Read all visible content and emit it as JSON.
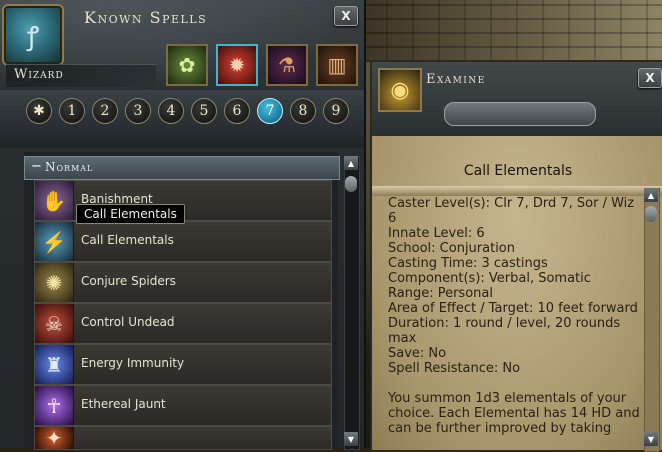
{
  "known_spells": {
    "title": "Known Spells",
    "close_label": "X",
    "class_name": "Wizard",
    "schools": [
      {
        "icon": "green-flower-icon",
        "glyph": "✿"
      },
      {
        "icon": "red-flame-icon",
        "glyph": "✹"
      },
      {
        "icon": "potion-flask-icon",
        "glyph": "⚗"
      },
      {
        "icon": "scroll-case-icon",
        "glyph": "▥"
      }
    ],
    "levels": [
      "✱",
      "1",
      "2",
      "3",
      "4",
      "5",
      "6",
      "7",
      "8",
      "9"
    ],
    "active_level": "7",
    "section_label": "Normal",
    "tooltip": "Call Elementals",
    "spells": [
      {
        "name": "Banishment",
        "icon": "banishment-icon",
        "glyph": "✋",
        "color": "#5a3a6a"
      },
      {
        "name": "Call Elementals",
        "icon": "call-elementals-icon",
        "glyph": "⚡",
        "color": "#2c5a78"
      },
      {
        "name": "Conjure Spiders",
        "icon": "spider-icon",
        "glyph": "✺",
        "color": "#6a5a2a"
      },
      {
        "name": "Control Undead",
        "icon": "skeleton-icon",
        "glyph": "☠",
        "color": "#6a2020"
      },
      {
        "name": "Energy Immunity",
        "icon": "energy-figure-icon",
        "glyph": "♜",
        "color": "#2a4ab0"
      },
      {
        "name": "Ethereal Jaunt",
        "icon": "ethereal-figure-icon",
        "glyph": "☥",
        "color": "#5a2aa0"
      },
      {
        "name": "",
        "icon": "partial-spell-icon",
        "glyph": "✦",
        "color": "#6a2a10"
      }
    ]
  },
  "examine": {
    "title": "Examine",
    "close_label": "X",
    "spell_title": "Call Elementals",
    "lines": [
      "Caster Level(s): Clr 7, Drd 7, Sor / Wiz",
      "6",
      "Innate Level: 6",
      "School: Conjuration",
      "Casting Time: 3 castings",
      "Component(s): Verbal, Somatic",
      "Range: Personal",
      "Area of Effect / Target: 10 feet forward",
      "Duration: 1 round / level, 20 rounds",
      "max",
      "Save: No",
      "Spell Resistance: No"
    ],
    "description": [
      "You summon 1d3 elementals of your",
      "choice. Each Elemental has 14 HD and",
      "can be further improved by taking"
    ]
  }
}
